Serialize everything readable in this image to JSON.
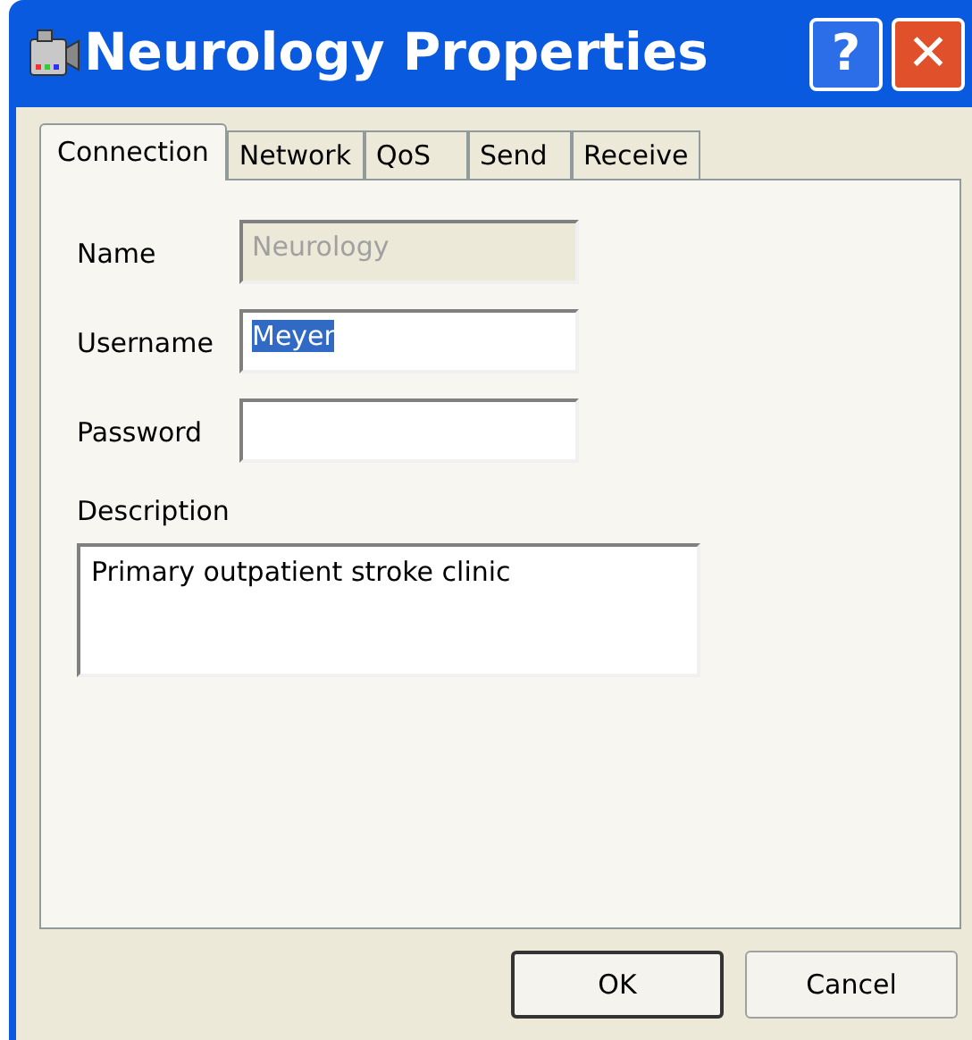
{
  "window": {
    "title": "Neurology Properties"
  },
  "title_buttons": [
    {
      "kind": "help",
      "label": "?"
    },
    {
      "kind": "close",
      "label": "✕"
    }
  ],
  "tabs": [
    {
      "label": "Connection",
      "selected": true
    },
    {
      "label": "Network",
      "selected": false
    },
    {
      "label": "QoS",
      "selected": false
    },
    {
      "label": "Send",
      "selected": false
    },
    {
      "label": "Receive",
      "selected": false
    }
  ],
  "fields": [
    {
      "label": "Name",
      "value": "Neurology",
      "disabled": true,
      "text_selected": false
    },
    {
      "label": "Username",
      "value": "Meyer",
      "disabled": false,
      "text_selected": true
    },
    {
      "label": "Password",
      "disabled": false
    }
  ],
  "description": {
    "label": "Description",
    "value": "Primary outpatient stroke clinic"
  },
  "buttons": [
    {
      "label": "OK",
      "default": true
    },
    {
      "label": "Cancel",
      "default": false
    }
  ]
}
